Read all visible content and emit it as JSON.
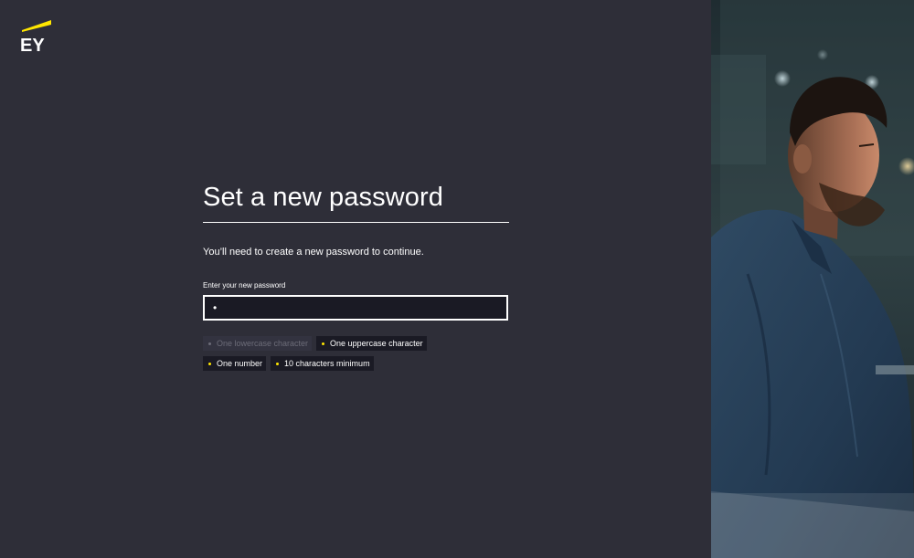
{
  "brand": {
    "name": "EY",
    "accent": "#ffe600",
    "background": "#2e2e38"
  },
  "form": {
    "title": "Set a new password",
    "subtitle": "You’ll need to create a new password to continue.",
    "field_label": "Enter your new password",
    "password_value": "•"
  },
  "requirements": [
    {
      "label": "One lowercase character",
      "met": true
    },
    {
      "label": "One uppercase character",
      "met": false
    },
    {
      "label": "One number",
      "met": false
    },
    {
      "label": "10 characters minimum",
      "met": false
    }
  ],
  "hero_image": {
    "icon": "man-at-laptop-photo"
  }
}
